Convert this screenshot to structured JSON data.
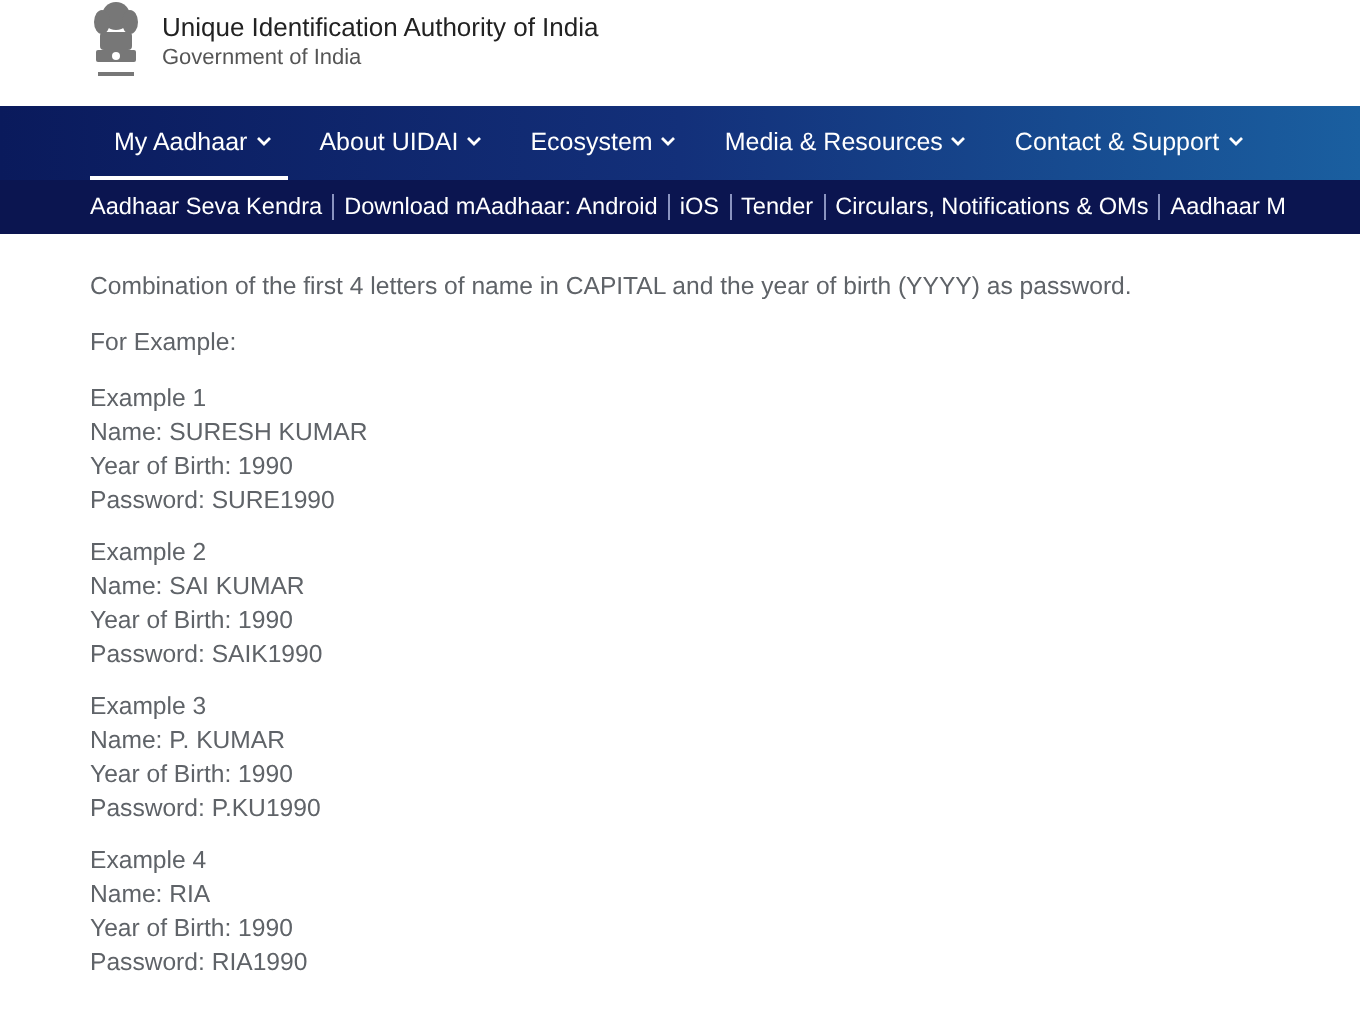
{
  "header": {
    "title": "Unique Identification Authority of India",
    "subtitle": "Government of India"
  },
  "nav": [
    {
      "label": "My Aadhaar",
      "selected": true
    },
    {
      "label": "About UIDAI",
      "selected": false
    },
    {
      "label": "Ecosystem",
      "selected": false
    },
    {
      "label": "Media & Resources",
      "selected": false
    },
    {
      "label": "Contact & Support",
      "selected": false
    }
  ],
  "quick_links": [
    "Aadhaar Seva Kendra",
    "Download mAadhaar: Android",
    "iOS",
    "Tender",
    "Circulars, Notifications & OMs",
    "Aadhaar M"
  ],
  "content": {
    "intro": "Combination of the first 4 letters of name in CAPITAL and the year of birth (YYYY) as password.",
    "lead": "For Example:",
    "examples": [
      {
        "title": "Example 1",
        "name": "Name: SURESH KUMAR",
        "year": "Year of Birth: 1990",
        "password": "Password: SURE1990"
      },
      {
        "title": "Example 2",
        "name": "Name: SAI KUMAR",
        "year": "Year of Birth: 1990",
        "password": "Password: SAIK1990"
      },
      {
        "title": "Example 3",
        "name": "Name: P. KUMAR",
        "year": "Year of Birth: 1990",
        "password": "Password: P.KU1990"
      },
      {
        "title": "Example 4",
        "name": "Name: RIA",
        "year": "Year of Birth: 1990",
        "password": "Password: RIA1990"
      }
    ]
  }
}
